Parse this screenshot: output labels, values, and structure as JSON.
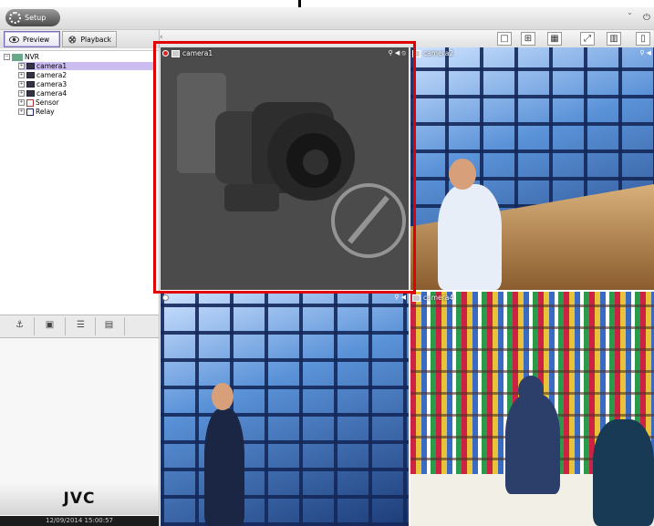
{
  "window": {
    "setup_label": "Setup"
  },
  "tabs": [
    {
      "label": "Preview",
      "icon": "eye-icon",
      "active": true
    },
    {
      "label": "Playback",
      "icon": "film-reel-icon",
      "active": false
    }
  ],
  "tree": {
    "root": "NVR",
    "items": [
      {
        "label": "camera1",
        "selected": true
      },
      {
        "label": "camera2"
      },
      {
        "label": "camera3"
      },
      {
        "label": "camera4"
      },
      {
        "label": "Sensor"
      },
      {
        "label": "Relay"
      }
    ]
  },
  "tools": [
    "ptz-icon",
    "snapshot-icon",
    "log-icon",
    "settings-panel-icon"
  ],
  "right_toolbar": [
    "single-view-icon",
    "quad-view-icon",
    "grid-view-icon",
    "fullscreen-icon",
    "record-icon",
    "storage-icon"
  ],
  "cameras": [
    {
      "label": "camera1",
      "status": "no-signal"
    },
    {
      "label": "camera2"
    },
    {
      "label": ""
    },
    {
      "label": "camera4"
    }
  ],
  "brand": "JVC",
  "datetime": "12/09/2014 15:00:57",
  "colors": {
    "selection": "#cbbdf0",
    "highlight_box": "#e20000"
  }
}
